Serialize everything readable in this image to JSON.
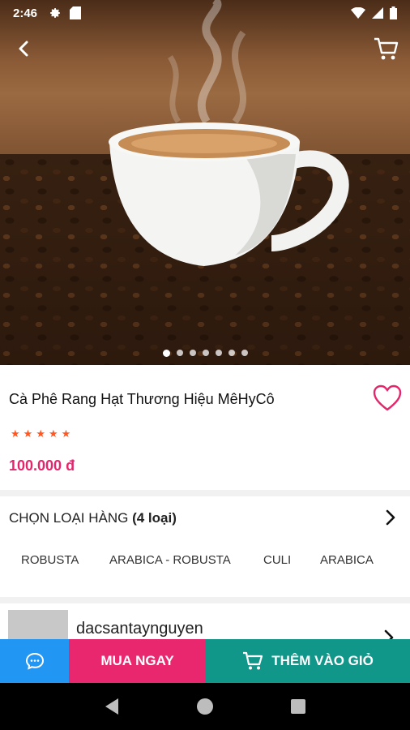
{
  "status_bar": {
    "time": "2:46",
    "icons": [
      "settings-icon",
      "sd-card-icon",
      "wifi-icon",
      "signal-icon",
      "battery-icon"
    ]
  },
  "header": {
    "back_icon": "back-arrow-icon",
    "cart_icon": "cart-icon"
  },
  "gallery": {
    "image": "coffee-cup-on-beans",
    "slide_count": 7,
    "active_index": 0
  },
  "product": {
    "title": "Cà Phê Rang Hạt Thương Hiệu MêHyCô",
    "rating_stars": 5,
    "star_glyphs": [
      "★",
      "★",
      "★",
      "★",
      "★"
    ],
    "price": "100.000 đ",
    "favorite_icon": "heart-outline-icon"
  },
  "variants": {
    "label": "CHỌN LOẠI HÀNG",
    "count_label": "(4 loại)",
    "items": [
      "ROBUSTA",
      "ARABICA - ROBUSTA",
      "CULI",
      "ARABICA"
    ]
  },
  "shop": {
    "name": "dacsantaynguyen"
  },
  "actions": {
    "chat_icon": "chat-bubble-icon",
    "buy_now_label": "MUA NGAY",
    "add_to_cart_label": "THÊM VÀO GIỎ"
  },
  "colors": {
    "price": "#e4276c",
    "stars": "#ff5722",
    "chat": "#2196f3",
    "buy_now": "#e9276f",
    "add_to_cart": "#11968a"
  }
}
